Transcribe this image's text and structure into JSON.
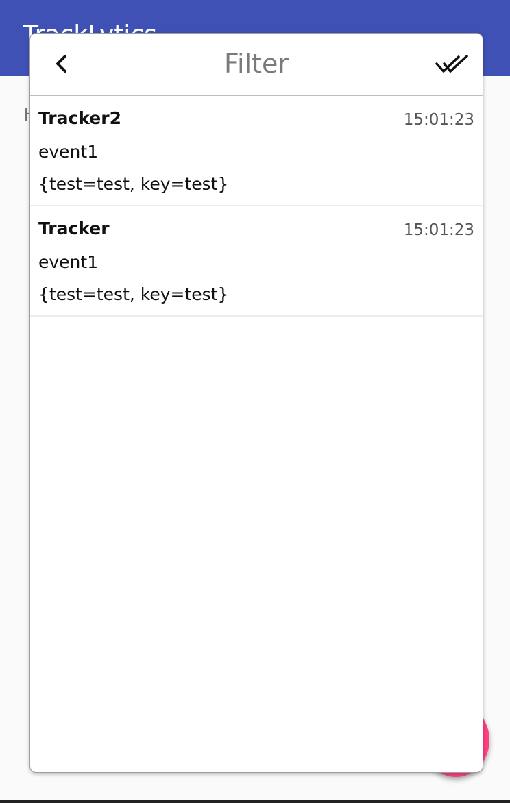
{
  "app": {
    "title": "TrackLytics",
    "body_hint": "H"
  },
  "dialog": {
    "title": "Filter",
    "back_icon": "chevron-left-icon",
    "confirm_icon": "double-check-icon"
  },
  "events": [
    {
      "tracker": "Tracker2",
      "time": "15:01:23",
      "name": "event1",
      "params": "{test=test, key=test}"
    },
    {
      "tracker": "Tracker",
      "time": "15:01:23",
      "name": "event1",
      "params": "{test=test, key=test}"
    }
  ],
  "colors": {
    "app_bar": "#3f51b5",
    "fab": "#ff4081",
    "title_text": "#7a7a7a"
  }
}
